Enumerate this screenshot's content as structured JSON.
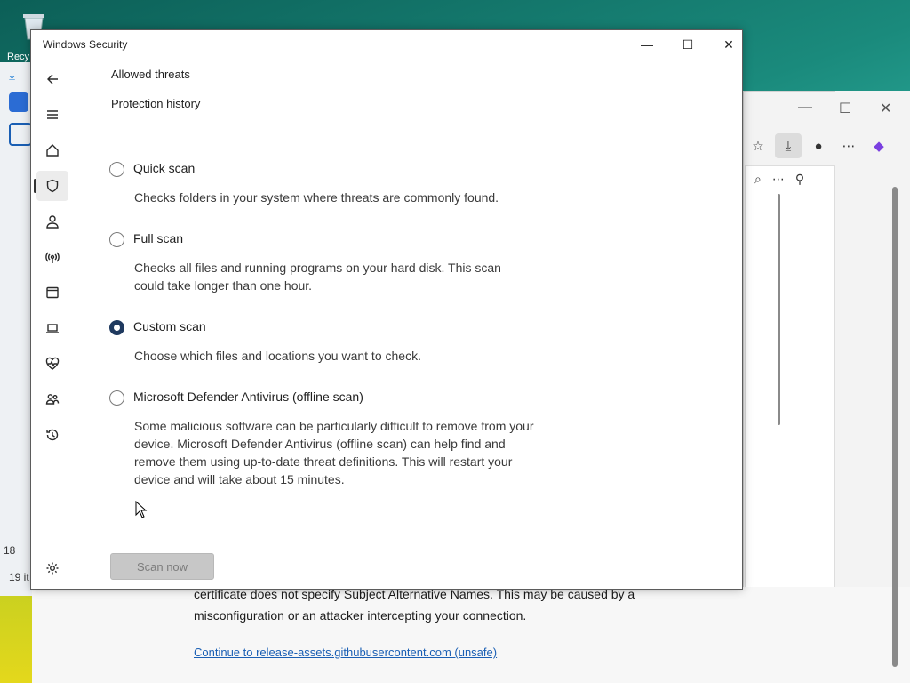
{
  "desktop": {
    "recycle_label": "Recy"
  },
  "background_browser": {
    "sidebar_text_1": "18",
    "sidebar_text_2": "19 it",
    "cert_line_1": "certificate does not specify Subject Alternative Names. This may be caused by a",
    "cert_line_2": "misconfiguration or an attacker intercepting your connection.",
    "continue_link": "Continue to release-assets.githubusercontent.com (unsafe)"
  },
  "window": {
    "title": "Windows Security",
    "minimize": "—",
    "maximize": "☐",
    "close": "✕"
  },
  "nav": {
    "items": [
      "back",
      "menu",
      "home",
      "virus-threat-protection",
      "account-protection",
      "firewall-network",
      "app-browser-control",
      "device-security",
      "device-performance-health",
      "family-options",
      "protection-history",
      "settings"
    ]
  },
  "content": {
    "allowed_threats": "Allowed threats",
    "protection_history": "Protection history",
    "options": [
      {
        "label": "Quick scan",
        "description": "Checks folders in your system where threats are commonly found.",
        "selected": false
      },
      {
        "label": "Full scan",
        "description": "Checks all files and running programs on your hard disk. This scan could take longer than one hour.",
        "selected": false
      },
      {
        "label": "Custom scan",
        "description": "Choose which files and locations you want to check.",
        "selected": true
      },
      {
        "label": "Microsoft Defender Antivirus (offline scan)",
        "description": "Some malicious software can be particularly difficult to remove from your device. Microsoft Defender Antivirus (offline scan) can help find and remove them using up-to-date threat definitions. This will restart your device and will take about 15 minutes.",
        "selected": false
      }
    ],
    "scan_button": "Scan now"
  }
}
